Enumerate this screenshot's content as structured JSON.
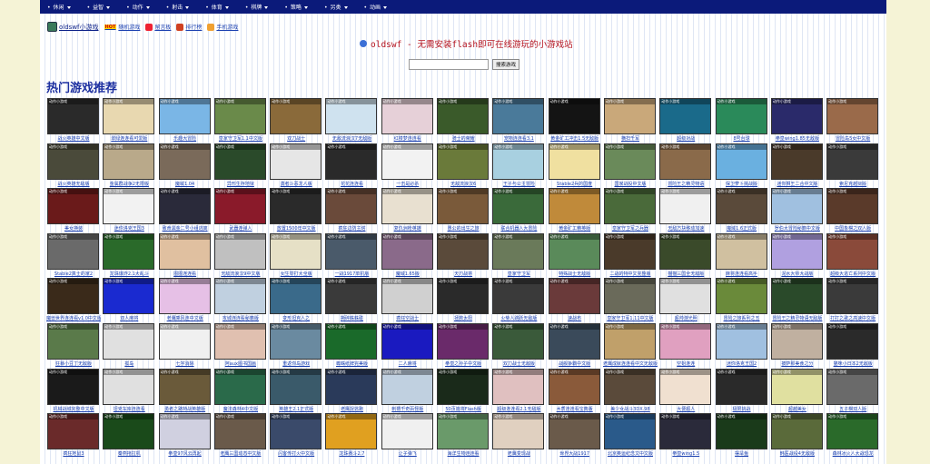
{
  "nav": [
    "休闲",
    "益智",
    "动作",
    "射击",
    "体育",
    "棋牌",
    "策略",
    "另类",
    "动画"
  ],
  "links": [
    {
      "label": "oldswf小游戏",
      "icon": "site-logo-icon",
      "color": "#3a7a5a"
    },
    {
      "label": "随机游戏",
      "icon": "hot-icon",
      "color": "#ffd400",
      "badge": "HOT"
    },
    {
      "label": "留言板",
      "icon": "message-icon",
      "color": "#e23"
    },
    {
      "label": "排行榜",
      "icon": "chart-icon",
      "color": "#d04020"
    },
    {
      "label": "手机游戏",
      "icon": "smile-icon",
      "color": "#f0a030"
    }
  ],
  "site_title": "oldswf - 无需安装flash即可在线游玩的小游戏站",
  "search": {
    "placeholder": "",
    "button": "搜索游戏"
  },
  "heading": "热门游戏推荐",
  "thumb_tag": "动作小游戏",
  "games": [
    {
      "t": "战火英雄中文版",
      "c": "#2a2a2a"
    },
    {
      "t": "翠绿连连看可爱版",
      "c": "#e8d8b0"
    },
    {
      "t": "乐趣大冒险",
      "c": "#7ab6e6"
    },
    {
      "t": "皇家守卫军1.1中文版",
      "c": "#6a8a4a"
    },
    {
      "t": "双刀战士",
      "c": "#8a6a3a"
    },
    {
      "t": "无敌流浪汉7无敌版",
      "c": "#cfe2ef"
    },
    {
      "t": "红楼梦连连看",
      "c": "#e6d0d8"
    },
    {
      "t": "骑士的荣耀",
      "c": "#3a5a2a"
    },
    {
      "t": "宠物连连看3.1",
      "c": "#4a7a9a"
    },
    {
      "t": "黄金矿工冲击1.5无敌版",
      "c": "#141414"
    },
    {
      "t": "横扫千军",
      "c": "#c9a87a"
    },
    {
      "t": "超级对战",
      "c": "#1a6a8a"
    },
    {
      "t": "8号台球",
      "c": "#2a8a5a"
    },
    {
      "t": "拳皇wing1.85无敌版",
      "c": "#2a2a6a"
    },
    {
      "t": "冒险岛5女中文版",
      "c": "#9a6a4a"
    },
    {
      "t": "战火英雄无敌版",
      "c": "#4a4a3a"
    },
    {
      "t": "金属群战争2无限版",
      "c": "#b9a98a"
    },
    {
      "t": "魔域1.04",
      "c": "#7a6a5a"
    },
    {
      "t": "异形生存地狱",
      "c": "#2a4a2a"
    },
    {
      "t": "勇者斗恶龙人版",
      "c": "#e6e6e6"
    },
    {
      "t": "花花连连看",
      "c": "#2a2a2a"
    },
    {
      "t": "一击是必杀",
      "c": "#f2f2f2"
    },
    {
      "t": "无敌流浪汉6",
      "c": "#6a7a3a"
    },
    {
      "t": "王子与公主冒险",
      "c": "#a8d0e0"
    },
    {
      "t": "Stable2兵的国度",
      "c": "#f0e0a0"
    },
    {
      "t": "国家战役中文版",
      "c": "#6a8a5a"
    },
    {
      "t": "冒险王之精灵物语",
      "c": "#8a6a4a"
    },
    {
      "t": "保卫萝卜挑战版",
      "c": "#6ab0e0"
    },
    {
      "t": "迷你狮王二合中文版",
      "c": "#4a3a2a"
    },
    {
      "t": "索尼克越狱版",
      "c": "#3a3a3a"
    },
    {
      "t": "美女换装",
      "c": "#6a1a1a"
    },
    {
      "t": "迷你洛克王国3",
      "c": "#f2f2f2"
    },
    {
      "t": "致命黑金二号小组逃离",
      "c": "#2a2a3a"
    },
    {
      "t": "武器连弹人",
      "c": "#8a1a2a"
    },
    {
      "t": "放置1500年中文版",
      "c": "#2a2a2a"
    },
    {
      "t": "疯狂边防主塔",
      "c": "#6a4a3a"
    },
    {
      "t": "复仇洲枪英雄",
      "c": "#e8e0d0"
    },
    {
      "t": "愚公的出生之旅",
      "c": "#7a5a3a"
    },
    {
      "t": "联合机器人大冒险",
      "c": "#3a6a3a"
    },
    {
      "t": "黄金矿工精英版",
      "c": "#c08a3a"
    },
    {
      "t": "皇家守卫军之兵器",
      "c": "#4a6a3a"
    },
    {
      "t": "无敌方块移动加速",
      "c": "#f0f0f0"
    },
    {
      "t": "魔域1.6正式版",
      "c": "#5a4a3a"
    },
    {
      "t": "罗伯大冒险秘籍中文版",
      "c": "#a0c0e0"
    },
    {
      "t": "中国象棋之双人版",
      "c": "#5a3a2a"
    },
    {
      "t": "Stable2真士的家2",
      "c": "#6a6a6a"
    },
    {
      "t": "龙珠爆炸2.1大乱斗",
      "c": "#2a6a2a"
    },
    {
      "t": "图图连连看",
      "c": "#e0c0a0"
    },
    {
      "t": "无敌流浪汉9中文版",
      "c": "#c0c0c0"
    },
    {
      "t": "女生零打大全版",
      "c": "#e6e0c6"
    },
    {
      "t": "一战1917单机版",
      "c": "#4a5a6a"
    },
    {
      "t": "魔域1.65版",
      "c": "#8a6a8a"
    },
    {
      "t": "天刃战将",
      "c": "#5a4a3a"
    },
    {
      "t": "皇家守卫军",
      "c": "#6a7a5a"
    },
    {
      "t": "特殊战士无敌版",
      "c": "#5a8a5a"
    },
    {
      "t": "二战的特中文完整版",
      "c": "#4a3a2a"
    },
    {
      "t": "猫猫三国全无敌版",
      "c": "#3a4a2a"
    },
    {
      "t": "麻将连连看高手",
      "c": "#d0c0a0"
    },
    {
      "t": "泥水大师大战版",
      "c": "#b0a0e0"
    },
    {
      "t": "超级大逃亡系列中文版",
      "c": "#8a4a3a"
    },
    {
      "t": "魔兽世界连连看v1.0中文版",
      "c": "#3a2a1a"
    },
    {
      "t": "双人麻将",
      "c": "#1a2ad0"
    },
    {
      "t": "老鹰乘风连中文版",
      "c": "#e6c0e6"
    },
    {
      "t": "攻城连连看秘籍版",
      "c": "#c0d0e0"
    },
    {
      "t": "变形坦克人之",
      "c": "#3a6a8a"
    },
    {
      "t": "撕碎蛛蛛碰",
      "c": "#3a3a3a"
    },
    {
      "t": "疯狂空战士",
      "c": "#d0d0d0"
    },
    {
      "t": "拯救太阳",
      "c": "#2a2a2a"
    },
    {
      "t": "火柴人跳跃无敌版",
      "c": "#3a3a3a"
    },
    {
      "t": "速战布",
      "c": "#6a3a3a"
    },
    {
      "t": "皇家守卫军1.11中文版",
      "c": "#6a6a5a"
    },
    {
      "t": "超帅游光明",
      "c": "#e0e0e0"
    },
    {
      "t": "冒险之旅系列之五",
      "c": "#6a8a3a"
    },
    {
      "t": "冒险王之精灵物语无敌版",
      "c": "#2a4a2a"
    },
    {
      "t": "打打之歌之高速中文版",
      "c": "#3a3a3a"
    },
    {
      "t": "狂暴小豆丁无敌版",
      "c": "#5a7a4a"
    },
    {
      "t": "孤岛",
      "c": "#e0e0e0"
    },
    {
      "t": "七字消除",
      "c": "#f0f0f0"
    },
    {
      "t": "阿aux图书国画",
      "c": "#e0c0b0"
    },
    {
      "t": "重返你岛游戏",
      "c": "#6a8aa0"
    },
    {
      "t": "蜘蛛纸牌完美版",
      "c": "#1a6a2a"
    },
    {
      "t": "二人麻将",
      "c": "#1a1ac0"
    },
    {
      "t": "拳皇之孙子中文版",
      "c": "#6a2a6a"
    },
    {
      "t": "双刀战士无敌版",
      "c": "#3a5a3a"
    },
    {
      "t": "战舰争霸中文版",
      "c": "#3a4a5a"
    },
    {
      "t": "老鹰成就连连看中文无敌版",
      "c": "#c0a06a"
    },
    {
      "t": "空姐连连",
      "c": "#e0a0c0"
    },
    {
      "t": "迷你洛克王国2",
      "c": "#a0c0e0"
    },
    {
      "t": "披萨那美食之分",
      "c": "#c0b0a0"
    },
    {
      "t": "猫咪小日本2无敌版",
      "c": "#2a2a2a"
    },
    {
      "t": "机械战城完整中文版",
      "c": "#1a1a1a"
    },
    {
      "t": "坦克车库连连看",
      "c": "#e0e0e0"
    },
    {
      "t": "勇者之路特战英雄版",
      "c": "#6a5a3a"
    },
    {
      "t": "魔法森林4中文版",
      "c": "#2a6a4a"
    },
    {
      "t": "英雄王2.1正式版",
      "c": "#3a5a6a"
    },
    {
      "t": "老鹰捉逃跑",
      "c": "#2a3a5a"
    },
    {
      "t": "刺猬千奇百怪版",
      "c": "#c0d0e0"
    },
    {
      "t": "50页篇将Flash版",
      "c": "#1a2a1a"
    },
    {
      "t": "超级连连看2.1无敌版",
      "c": "#e0c0c0"
    },
    {
      "t": "木质连连看宝典版",
      "c": "#8a5a3a"
    },
    {
      "t": "美少女战斗3DX.98",
      "c": "#5a4a3a"
    },
    {
      "t": "大便超人",
      "c": "#f0e0d0"
    },
    {
      "t": "极限挑战",
      "c": "#2a2a2a"
    },
    {
      "t": "超越美女",
      "c": "#e0e0a0"
    },
    {
      "t": "五子棋双人版",
      "c": "#6a6a6a"
    },
    {
      "t": "疯狂地鼠3",
      "c": "#6a2a2a"
    },
    {
      "t": "秦燕拖拉机",
      "c": "#1a4a1a"
    },
    {
      "t": "拳皇97风云再起",
      "c": "#d0d0e0"
    },
    {
      "t": "老鹰三国动态中文版",
      "c": "#6a5a4a"
    },
    {
      "t": "闪客传打火中文版",
      "c": "#3a4a6a"
    },
    {
      "t": "龙珠赛斗2.7",
      "c": "#e0a020"
    },
    {
      "t": "让子弹飞",
      "c": "#f0f0f0"
    },
    {
      "t": "海洋生物连连看",
      "c": "#6a9a6a"
    },
    {
      "t": "老鹰变现战",
      "c": "#e0d0c0"
    },
    {
      "t": "世界大战1917",
      "c": "#6a5a4a"
    },
    {
      "t": "北京奥运纪念文中文版",
      "c": "#2a5a8a"
    },
    {
      "t": "拳皇wing1.5",
      "c": "#2a2a3a"
    },
    {
      "t": "摆旱鱼",
      "c": "#1a3a1a"
    },
    {
      "t": "韩医战役4无敌版",
      "c": "#5a6a3a"
    },
    {
      "t": "森林冰火人大战恐龙",
      "c": "#2a6a2a"
    }
  ]
}
